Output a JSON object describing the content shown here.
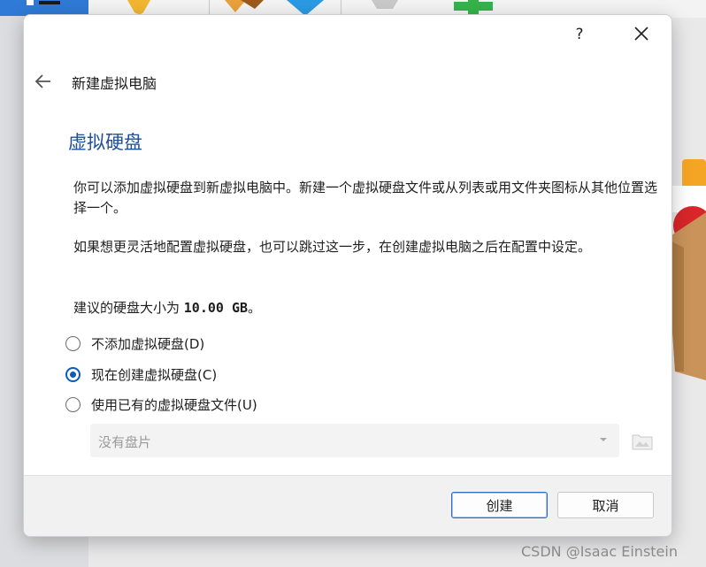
{
  "dialog": {
    "help_label": "?",
    "wizard_title": "新建虚拟电脑",
    "section_title": "虚拟硬盘",
    "paragraph1": "你可以添加虚拟硬盘到新虚拟电脑中。新建一个虚拟硬盘文件或从列表或用文件夹图标从其他位置选择一个。",
    "paragraph2": "如果想更灵活地配置虚拟硬盘，也可以跳过这一步，在创建虚拟电脑之后在配置中设定。",
    "recommend_prefix": "建议的硬盘大小为 ",
    "recommend_size": "10.00 GB",
    "recommend_suffix": "。",
    "options": [
      {
        "label": "不添加虚拟硬盘(D)",
        "checked": false
      },
      {
        "label": "现在创建虚拟硬盘(C)",
        "checked": true
      },
      {
        "label": "使用已有的虚拟硬盘文件(U)",
        "checked": false
      }
    ],
    "combo_value": "没有盘片",
    "buttons": {
      "create": "创建",
      "cancel": "取消"
    }
  },
  "watermark": "CSDN @Isaac Einstein",
  "colors": {
    "accent": "#0f5bb5",
    "section_title": "#1f4f96"
  }
}
